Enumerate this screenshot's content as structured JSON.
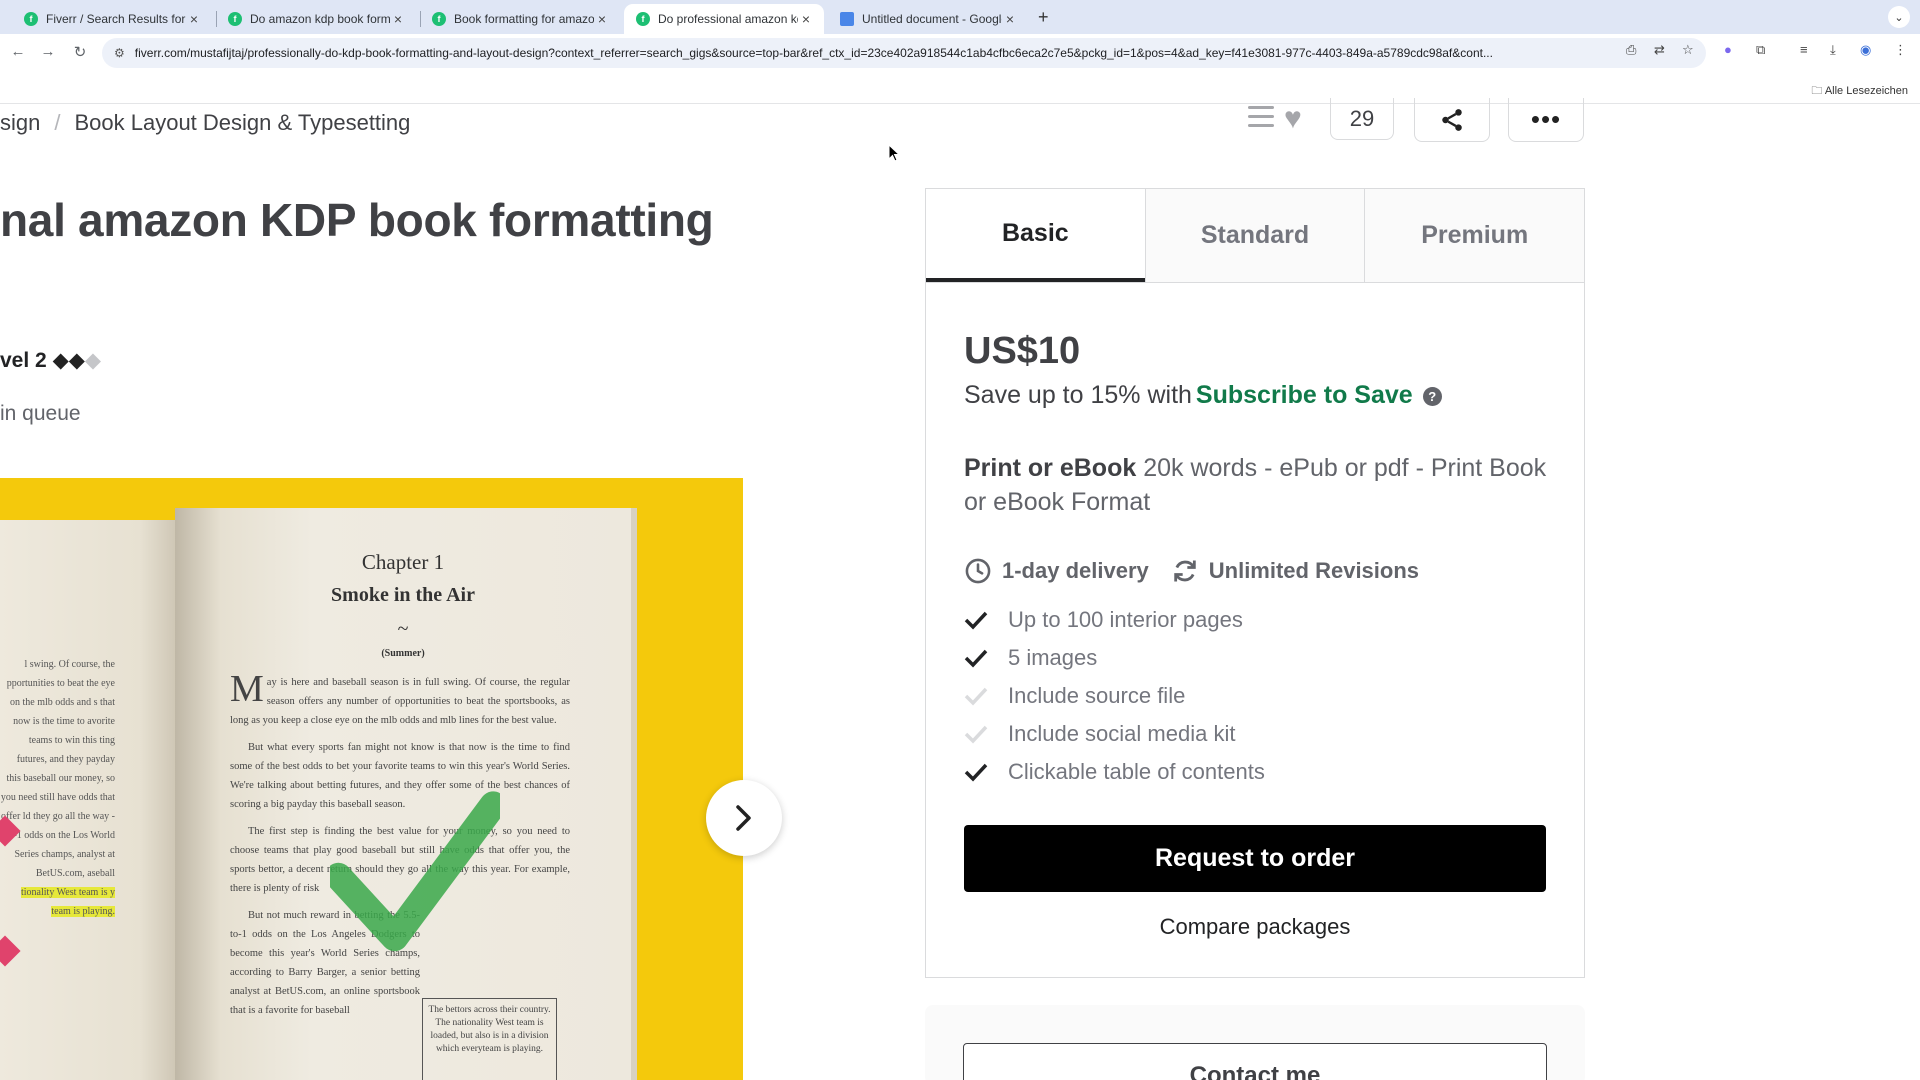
{
  "browser": {
    "tabs": [
      {
        "title": "Fiverr / Search Results for 'kdp",
        "favicon": "F",
        "active": false
      },
      {
        "title": "Do amazon kdp book formatting",
        "favicon": "F",
        "active": false
      },
      {
        "title": "Book formatting for amazon k",
        "favicon": "F",
        "active": false
      },
      {
        "title": "Do professional amazon kdp b",
        "favicon": "F",
        "active": true
      },
      {
        "title": "Untitled document - Google D",
        "favicon": "doc",
        "active": false
      }
    ],
    "url": "fiverr.com/mustafijtaj/professionally-do-kdp-book-formatting-and-layout-design?context_referrer=search_gigs&source=top-bar&ref_ctx_id=23ce402a918544c1ab4cfbc6eca2c7e5&pckg_id=1&pos=4&ad_key=f41e3081-977c-4403-849a-a5789cdc98af&cont...",
    "bookmarks_label": "Alle Lesezeichen"
  },
  "breadcrumb": {
    "prev": "sign",
    "current": "Book Layout Design & Typesetting"
  },
  "actions": {
    "like_count": "29"
  },
  "gig": {
    "title": "nal amazon KDP book formatting",
    "level": "vel 2",
    "queue": "in queue"
  },
  "book_image": {
    "chapter": "Chapter 1",
    "chapter_title": "Smoke in the Air",
    "ornament": "~",
    "season": "(Summer)",
    "drop_cap": "M",
    "para1": "ay is here and baseball season is in full swing. Of course, the regular season offers any number of opportunities to beat the sportsbooks, as long as you keep a close eye on the mlb odds and mlb lines for the best value.",
    "para2": "But what every sports fan might not know is that now is the time to find some of the best odds to bet your favorite teams to win this year's World Series. We're talking about betting futures, and they offer some of the best chances of scoring a big payday this baseball season.",
    "para3": "The first step is finding the best value for your money, so you need to choose teams that play good baseball but still have odds that offer you, the sports bettor, a decent return should they go all the way this year. For example, there is plenty of risk",
    "para4": "But not much reward in betting the 5.5-to-1 odds on the Los Angeles Dodgers to become this year's World Series champs, according to Barry Barger, a senior betting analyst at BetUS.com, an online sportsbook that is a favorite for baseball",
    "box": "The bettors across their country. The nationality West team is loaded, but also is in a division which everyteam is playing.",
    "left_text": "l swing. Of course, the pportunities to beat the eye on the mlb odds and  s that now is the time to avorite teams to win this ting futures, and they payday this baseball  our money, so you need still have odds that offer ld they go all the way  -to-1 odds on the Los World Series champs, analyst at BetUS.com, aseball",
    "left_highlight": "tionality West team is y team is playing."
  },
  "package": {
    "tabs": [
      "Basic",
      "Standard",
      "Premium"
    ],
    "active_tab": "Basic",
    "price": "US$10",
    "save_text": "Save up to 15% with",
    "subscribe_link": "Subscribe to Save",
    "desc_bold": "Print or eBook",
    "desc_rest": "20k words - ePub or pdf - Print Book or eBook Format",
    "delivery": "1-day delivery",
    "revisions": "Unlimited Revisions",
    "features": [
      {
        "label": "Up to 100 interior pages",
        "included": true
      },
      {
        "label": "5 images",
        "included": true
      },
      {
        "label": "Include source file",
        "included": false
      },
      {
        "label": "Include social media kit",
        "included": false
      },
      {
        "label": "Clickable table of contents",
        "included": true
      }
    ],
    "request_button": "Request to order",
    "compare_link": "Compare packages"
  },
  "contact": {
    "button": "Contact me"
  },
  "colors": {
    "accent_green": "#117a4a",
    "gallery_bg": "#f4c90c",
    "button_black": "#000000"
  }
}
